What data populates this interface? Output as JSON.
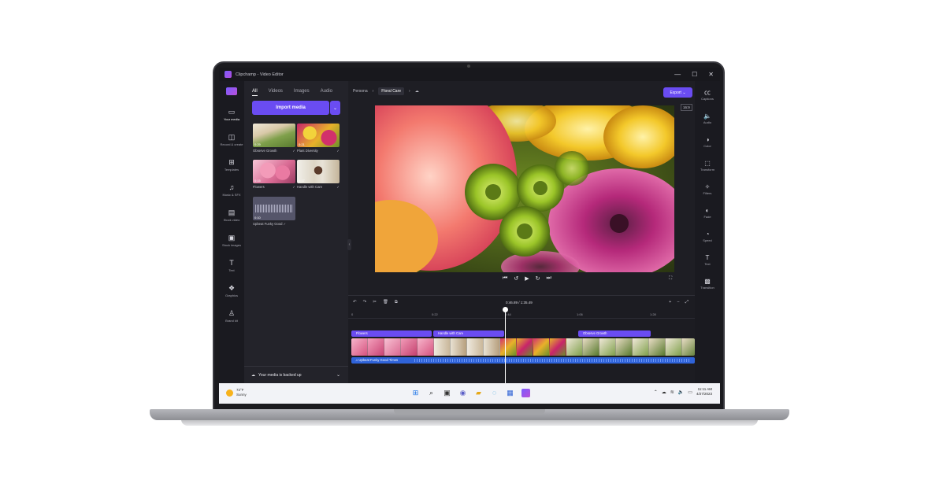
{
  "window": {
    "title": "Clipchamp - Video Editor",
    "controls": [
      "—",
      "☐",
      "✕"
    ]
  },
  "left_rail": [
    {
      "label": "Your media",
      "icon": "folder-icon",
      "glyph": "▭"
    },
    {
      "label": "Record & create",
      "icon": "camera-icon",
      "glyph": "◫"
    },
    {
      "label": "Templates",
      "icon": "templates-icon",
      "glyph": "⊞"
    },
    {
      "label": "Music & SFX",
      "icon": "music-icon",
      "glyph": "♫"
    },
    {
      "label": "Stock video",
      "icon": "film-icon",
      "glyph": "▤"
    },
    {
      "label": "Stock images",
      "icon": "image-icon",
      "glyph": "▣"
    },
    {
      "label": "Text",
      "icon": "text-icon",
      "glyph": "T"
    },
    {
      "label": "Graphics",
      "icon": "graphics-icon",
      "glyph": "❖"
    },
    {
      "label": "Brand kit",
      "icon": "brand-kit-icon",
      "glyph": "♙"
    }
  ],
  "media_panel": {
    "tabs": [
      "All",
      "Videos",
      "Images",
      "Audio"
    ],
    "import_label": "Import media",
    "items": [
      {
        "name": "Observe Growth",
        "duration": "0:29"
      },
      {
        "name": "Plant Diversity",
        "duration": "0:21"
      },
      {
        "name": "Flowers",
        "duration": "0:15"
      },
      {
        "name": "Handle with Care",
        "duration": "0:17"
      },
      {
        "name": "Upbeat Funky Good",
        "duration": "0:10"
      }
    ],
    "backup_text": "Your media is backed up"
  },
  "breadcrumb": {
    "parent": "Persona",
    "current": "Floral Care"
  },
  "export_label": "Export",
  "aspect_ratio": "16:9",
  "right_rail": [
    {
      "label": "Captions",
      "icon": "captions-icon",
      "glyph": "㏄"
    },
    {
      "label": "Audio",
      "icon": "speaker-icon",
      "glyph": "🔈"
    },
    {
      "label": "Color",
      "icon": "color-icon",
      "glyph": "◑"
    },
    {
      "label": "Transform",
      "icon": "transform-icon",
      "glyph": "⬚"
    },
    {
      "label": "Filters",
      "icon": "filters-icon",
      "glyph": "✧"
    },
    {
      "label": "Fade",
      "icon": "fade-icon",
      "glyph": "◐"
    },
    {
      "label": "Speed",
      "icon": "speed-icon",
      "glyph": "◔"
    },
    {
      "label": "Text",
      "icon": "text-icon",
      "glyph": "T"
    },
    {
      "label": "Transition",
      "icon": "transition-icon",
      "glyph": "▩"
    }
  ],
  "timeline": {
    "current_time": "0:46.89",
    "total_time": "1:35.49",
    "ticks": [
      "0",
      "0:22",
      "0:44",
      "1:06",
      "1:28"
    ],
    "clips": [
      "Flowers",
      "Handle with Care",
      "Observe Growth"
    ],
    "audio_clip": "Upbeat Funky Good Times"
  },
  "taskbar": {
    "weather_temp": "72°F",
    "weather_desc": "Sunny",
    "time": "11:11 AM",
    "date": "4/27/2023"
  },
  "colors": {
    "accent": "#6a4cf2",
    "audio": "#2f63d9",
    "bg": "#1e1e24"
  }
}
